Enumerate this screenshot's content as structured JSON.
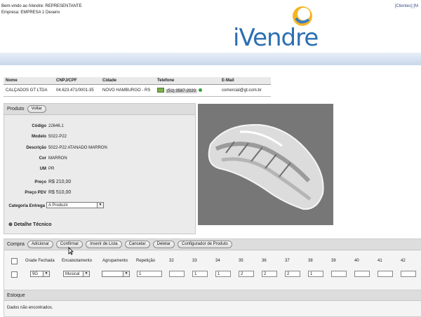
{
  "header": {
    "welcome": "Bem-vindo ao iVendre: REPRESENTANTE",
    "company": "Empresa: EMPRESA 1 Desenv",
    "top_links": "[Clientes] [M",
    "logo_text": "iVendre"
  },
  "client": {
    "columns": [
      "Nome",
      "CNPJ/CPF",
      "Cidade",
      "Telefone",
      "E-Mail"
    ],
    "row": {
      "nome": "CALÇADOS GT LTDA",
      "cnpj": "04.623.471/0001-35",
      "cidade": "NOVO HAMBURGO - RS",
      "telefone": "(51) 3587-2020",
      "email": "comercial@gt.com.br"
    }
  },
  "produto": {
    "title": "Produto",
    "back_label": "Voltar",
    "codigo_label": "Código",
    "codigo": "22646.1",
    "modelo_label": "Modelo",
    "modelo": "5022-P22",
    "descricao_label": "Descrição",
    "descricao": "5022-P22 ATANADO MARRON",
    "cor_label": "Cor",
    "cor": "MARRON",
    "um_label": "UM",
    "um": "PR",
    "preco_label": "Preço",
    "preco": "R$ 210,00",
    "preco_pdv_label": "Preço PDV",
    "preco_pdv": "R$ 510,00",
    "categoria_label": "Categoria Entrega",
    "categoria": "A Produzir",
    "detalhe": "Detalhe Técnico"
  },
  "compra": {
    "title": "Compra",
    "buttons": [
      "Adicionar",
      "Confirmar",
      "Inserir de Lista",
      "Cancelar",
      "Deletar",
      "Configurador de Produto"
    ],
    "headers": [
      "Grade Fechada",
      "Encaixotamento",
      "Agrupamento",
      "Repetição",
      "32",
      "33",
      "34",
      "35",
      "36",
      "37",
      "38",
      "39",
      "40",
      "41",
      "42"
    ],
    "row": {
      "grade": "9G",
      "encaixotamento": "Musical",
      "agrupamento": "",
      "repeticao": "1",
      "sizes": [
        "",
        "1",
        "1",
        "2",
        "2",
        "2",
        "1",
        "",
        "",
        "",
        ""
      ]
    }
  },
  "estoque": {
    "title": "Estoque",
    "message": "Dados não encontrados."
  }
}
